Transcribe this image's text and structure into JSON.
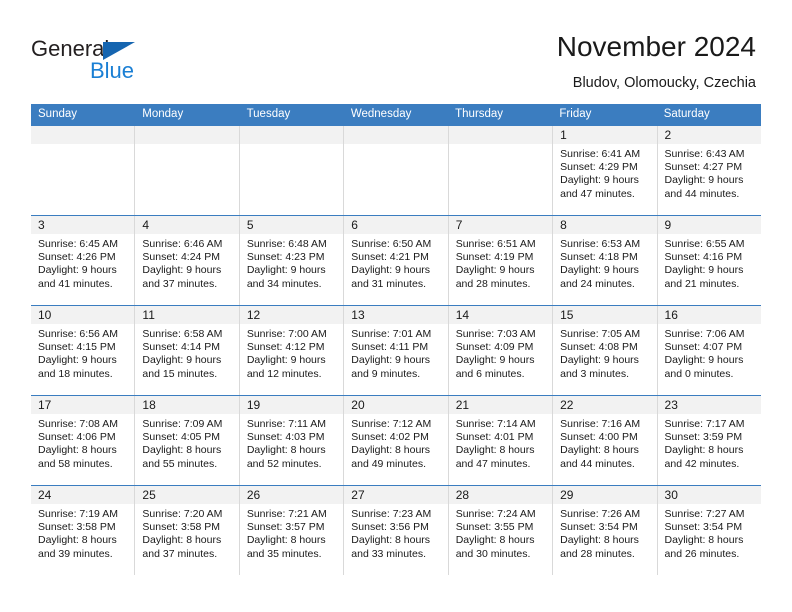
{
  "brand": {
    "name_part1": "General",
    "name_part2": "Blue",
    "triangle_color": "#1565b0",
    "blue_text_color": "#1a7fd4"
  },
  "header": {
    "title": "November 2024",
    "subtitle": "Bludov, Olomoucky, Czechia"
  },
  "theme": {
    "header_blue": "#3b7dc0",
    "daynum_bar": "#f2f2f2",
    "cell_border": "#d9d9d9"
  },
  "weekdays": [
    "Sunday",
    "Monday",
    "Tuesday",
    "Wednesday",
    "Thursday",
    "Friday",
    "Saturday"
  ],
  "weeks": [
    [
      {
        "day": "",
        "sunrise": "",
        "sunset": "",
        "daylight1": "",
        "daylight2": ""
      },
      {
        "day": "",
        "sunrise": "",
        "sunset": "",
        "daylight1": "",
        "daylight2": ""
      },
      {
        "day": "",
        "sunrise": "",
        "sunset": "",
        "daylight1": "",
        "daylight2": ""
      },
      {
        "day": "",
        "sunrise": "",
        "sunset": "",
        "daylight1": "",
        "daylight2": ""
      },
      {
        "day": "",
        "sunrise": "",
        "sunset": "",
        "daylight1": "",
        "daylight2": ""
      },
      {
        "day": "1",
        "sunrise": "Sunrise: 6:41 AM",
        "sunset": "Sunset: 4:29 PM",
        "daylight1": "Daylight: 9 hours",
        "daylight2": "and 47 minutes."
      },
      {
        "day": "2",
        "sunrise": "Sunrise: 6:43 AM",
        "sunset": "Sunset: 4:27 PM",
        "daylight1": "Daylight: 9 hours",
        "daylight2": "and 44 minutes."
      }
    ],
    [
      {
        "day": "3",
        "sunrise": "Sunrise: 6:45 AM",
        "sunset": "Sunset: 4:26 PM",
        "daylight1": "Daylight: 9 hours",
        "daylight2": "and 41 minutes."
      },
      {
        "day": "4",
        "sunrise": "Sunrise: 6:46 AM",
        "sunset": "Sunset: 4:24 PM",
        "daylight1": "Daylight: 9 hours",
        "daylight2": "and 37 minutes."
      },
      {
        "day": "5",
        "sunrise": "Sunrise: 6:48 AM",
        "sunset": "Sunset: 4:23 PM",
        "daylight1": "Daylight: 9 hours",
        "daylight2": "and 34 minutes."
      },
      {
        "day": "6",
        "sunrise": "Sunrise: 6:50 AM",
        "sunset": "Sunset: 4:21 PM",
        "daylight1": "Daylight: 9 hours",
        "daylight2": "and 31 minutes."
      },
      {
        "day": "7",
        "sunrise": "Sunrise: 6:51 AM",
        "sunset": "Sunset: 4:19 PM",
        "daylight1": "Daylight: 9 hours",
        "daylight2": "and 28 minutes."
      },
      {
        "day": "8",
        "sunrise": "Sunrise: 6:53 AM",
        "sunset": "Sunset: 4:18 PM",
        "daylight1": "Daylight: 9 hours",
        "daylight2": "and 24 minutes."
      },
      {
        "day": "9",
        "sunrise": "Sunrise: 6:55 AM",
        "sunset": "Sunset: 4:16 PM",
        "daylight1": "Daylight: 9 hours",
        "daylight2": "and 21 minutes."
      }
    ],
    [
      {
        "day": "10",
        "sunrise": "Sunrise: 6:56 AM",
        "sunset": "Sunset: 4:15 PM",
        "daylight1": "Daylight: 9 hours",
        "daylight2": "and 18 minutes."
      },
      {
        "day": "11",
        "sunrise": "Sunrise: 6:58 AM",
        "sunset": "Sunset: 4:14 PM",
        "daylight1": "Daylight: 9 hours",
        "daylight2": "and 15 minutes."
      },
      {
        "day": "12",
        "sunrise": "Sunrise: 7:00 AM",
        "sunset": "Sunset: 4:12 PM",
        "daylight1": "Daylight: 9 hours",
        "daylight2": "and 12 minutes."
      },
      {
        "day": "13",
        "sunrise": "Sunrise: 7:01 AM",
        "sunset": "Sunset: 4:11 PM",
        "daylight1": "Daylight: 9 hours",
        "daylight2": "and 9 minutes."
      },
      {
        "day": "14",
        "sunrise": "Sunrise: 7:03 AM",
        "sunset": "Sunset: 4:09 PM",
        "daylight1": "Daylight: 9 hours",
        "daylight2": "and 6 minutes."
      },
      {
        "day": "15",
        "sunrise": "Sunrise: 7:05 AM",
        "sunset": "Sunset: 4:08 PM",
        "daylight1": "Daylight: 9 hours",
        "daylight2": "and 3 minutes."
      },
      {
        "day": "16",
        "sunrise": "Sunrise: 7:06 AM",
        "sunset": "Sunset: 4:07 PM",
        "daylight1": "Daylight: 9 hours",
        "daylight2": "and 0 minutes."
      }
    ],
    [
      {
        "day": "17",
        "sunrise": "Sunrise: 7:08 AM",
        "sunset": "Sunset: 4:06 PM",
        "daylight1": "Daylight: 8 hours",
        "daylight2": "and 58 minutes."
      },
      {
        "day": "18",
        "sunrise": "Sunrise: 7:09 AM",
        "sunset": "Sunset: 4:05 PM",
        "daylight1": "Daylight: 8 hours",
        "daylight2": "and 55 minutes."
      },
      {
        "day": "19",
        "sunrise": "Sunrise: 7:11 AM",
        "sunset": "Sunset: 4:03 PM",
        "daylight1": "Daylight: 8 hours",
        "daylight2": "and 52 minutes."
      },
      {
        "day": "20",
        "sunrise": "Sunrise: 7:12 AM",
        "sunset": "Sunset: 4:02 PM",
        "daylight1": "Daylight: 8 hours",
        "daylight2": "and 49 minutes."
      },
      {
        "day": "21",
        "sunrise": "Sunrise: 7:14 AM",
        "sunset": "Sunset: 4:01 PM",
        "daylight1": "Daylight: 8 hours",
        "daylight2": "and 47 minutes."
      },
      {
        "day": "22",
        "sunrise": "Sunrise: 7:16 AM",
        "sunset": "Sunset: 4:00 PM",
        "daylight1": "Daylight: 8 hours",
        "daylight2": "and 44 minutes."
      },
      {
        "day": "23",
        "sunrise": "Sunrise: 7:17 AM",
        "sunset": "Sunset: 3:59 PM",
        "daylight1": "Daylight: 8 hours",
        "daylight2": "and 42 minutes."
      }
    ],
    [
      {
        "day": "24",
        "sunrise": "Sunrise: 7:19 AM",
        "sunset": "Sunset: 3:58 PM",
        "daylight1": "Daylight: 8 hours",
        "daylight2": "and 39 minutes."
      },
      {
        "day": "25",
        "sunrise": "Sunrise: 7:20 AM",
        "sunset": "Sunset: 3:58 PM",
        "daylight1": "Daylight: 8 hours",
        "daylight2": "and 37 minutes."
      },
      {
        "day": "26",
        "sunrise": "Sunrise: 7:21 AM",
        "sunset": "Sunset: 3:57 PM",
        "daylight1": "Daylight: 8 hours",
        "daylight2": "and 35 minutes."
      },
      {
        "day": "27",
        "sunrise": "Sunrise: 7:23 AM",
        "sunset": "Sunset: 3:56 PM",
        "daylight1": "Daylight: 8 hours",
        "daylight2": "and 33 minutes."
      },
      {
        "day": "28",
        "sunrise": "Sunrise: 7:24 AM",
        "sunset": "Sunset: 3:55 PM",
        "daylight1": "Daylight: 8 hours",
        "daylight2": "and 30 minutes."
      },
      {
        "day": "29",
        "sunrise": "Sunrise: 7:26 AM",
        "sunset": "Sunset: 3:54 PM",
        "daylight1": "Daylight: 8 hours",
        "daylight2": "and 28 minutes."
      },
      {
        "day": "30",
        "sunrise": "Sunrise: 7:27 AM",
        "sunset": "Sunset: 3:54 PM",
        "daylight1": "Daylight: 8 hours",
        "daylight2": "and 26 minutes."
      }
    ]
  ]
}
